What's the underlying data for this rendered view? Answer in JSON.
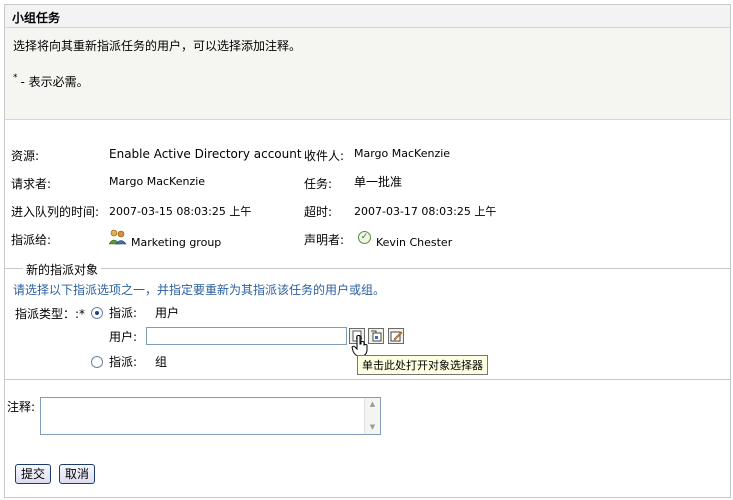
{
  "window": {
    "title": "小组任务"
  },
  "intro": {
    "text": "选择将向其重新指派任务的用户，可以选择添加注释。",
    "required_note": "- 表示必需。",
    "required_star": "*"
  },
  "details": {
    "resource_label": "资源:",
    "resource_value": "Enable Active Directory account",
    "recipient_label": "收件人:",
    "recipient_value": "Margo MacKenzie",
    "requester_label": "请求者:",
    "requester_value": "Margo MacKenzie",
    "task_label": "任务:",
    "task_value": "单一批准",
    "queued_label": "进入队列的时间:",
    "queued_value": "2007-03-15 08:03:25 上午",
    "timeout_label": "超时:",
    "timeout_value": "2007-03-17 08:03:25 上午",
    "assigned_label": "指派给:",
    "assigned_value": "Marketing group",
    "assigned_icon": "group-icon",
    "claimer_label": "声明者:",
    "claimer_value": "Kevin Chester",
    "claimer_icon": "check-icon"
  },
  "reassign": {
    "legend": "新的指派对象",
    "hint": "请选择以下指派选项之一，并指定要重新为其指派该任务的用户或组。",
    "type_label": "指派类型：:*",
    "option_user_prefix": "指派:",
    "option_user": "用户",
    "user_field_label": "用户:",
    "user_field_value": "",
    "option_group_prefix": "指派:",
    "option_group": "组",
    "selected": "user",
    "tooltip": "单击此处打开对象选择器"
  },
  "comment": {
    "label": "注释:",
    "value": ""
  },
  "buttons": {
    "submit": "提交",
    "cancel": "取消"
  },
  "colors": {
    "hint": "#2b5f9e",
    "button_border": "#1c3a70"
  }
}
